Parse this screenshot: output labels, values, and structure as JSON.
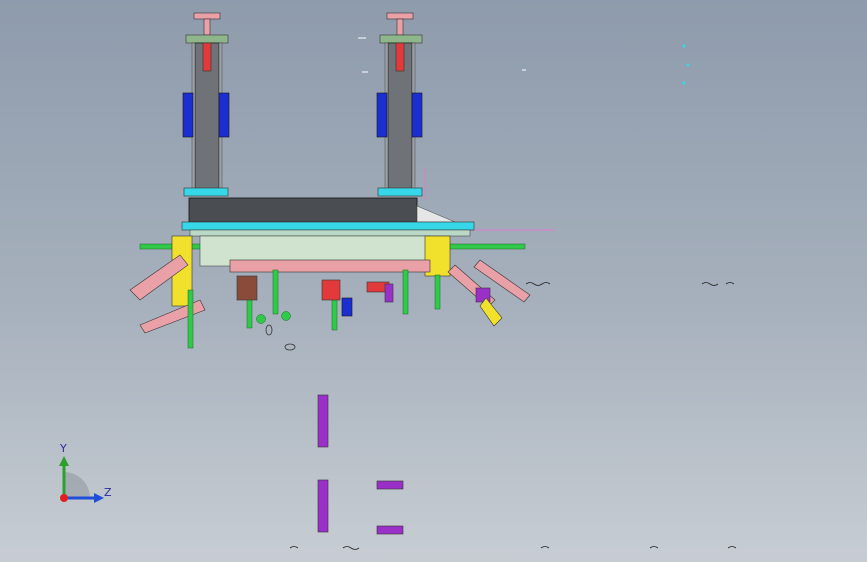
{
  "triad": {
    "y_label": "Y",
    "z_label": "Z",
    "colors": {
      "y_axis": "#2ca02c",
      "z_axis": "#1f4fd8",
      "origin": "#e02020"
    }
  },
  "model": {
    "description_colors": {
      "column": "#6f7378",
      "beam": "#4a4d52",
      "blue_plate": "#1b2fd1",
      "cyan_plate": "#36d7e8",
      "red_cylinder": "#e23a3a",
      "pink_arm": "#e9a0a6",
      "green_rod": "#31c94a",
      "yellow_part": "#f2e12c",
      "purple_block": "#9b30c8"
    }
  }
}
